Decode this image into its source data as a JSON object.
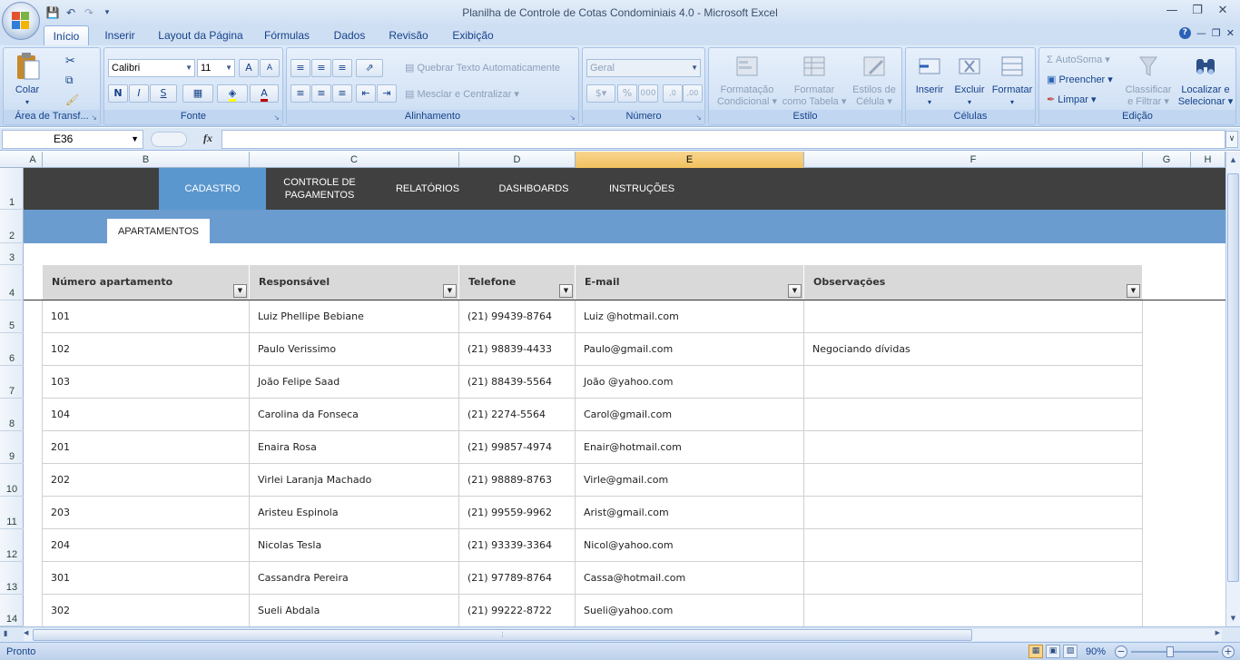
{
  "window": {
    "title": "Planilha de Controle de Cotas Condominiais 4.0  -  Microsoft Excel",
    "controls": [
      "minimize",
      "restore",
      "close"
    ]
  },
  "ribbon_tabs": [
    {
      "label": "Início",
      "active": true
    },
    {
      "label": "Inserir"
    },
    {
      "label": "Layout da Página"
    },
    {
      "label": "Fórmulas"
    },
    {
      "label": "Dados"
    },
    {
      "label": "Revisão"
    },
    {
      "label": "Exibição"
    }
  ],
  "ribbon": {
    "clipboard": {
      "label": "Área de Transf...",
      "paste": "Colar"
    },
    "font": {
      "label": "Fonte",
      "name": "Calibri",
      "size": "11",
      "bold": "N",
      "italic": "I",
      "underline": "S",
      "grow": "A",
      "shrink": "A",
      "color": "A"
    },
    "alignment": {
      "label": "Alinhamento",
      "wrap": "Quebrar Texto Automaticamente",
      "merge": "Mesclar e Centralizar"
    },
    "number": {
      "label": "Número",
      "format": "Geral",
      "percent": "%",
      "thousands": "000",
      "inc_decimal": ",0",
      "dec_decimal": ",00"
    },
    "styles": {
      "label": "Estilo",
      "conditional_1": "Formatação",
      "conditional_2": "Condicional",
      "table_1": "Formatar",
      "table_2": "como Tabela",
      "cell_styles_1": "Estilos de",
      "cell_styles_2": "Célula"
    },
    "cells": {
      "label": "Células",
      "insert": "Inserir",
      "delete": "Excluir",
      "format": "Formatar"
    },
    "editing": {
      "label": "Edição",
      "autosum": "AutoSoma",
      "fill": "Preencher",
      "clear": "Limpar",
      "sort_1": "Classificar",
      "sort_2": "e Filtrar",
      "find_1": "Localizar e",
      "find_2": "Selecionar"
    }
  },
  "formula_bar": {
    "name_box": "E36",
    "fx": "fx",
    "formula": ""
  },
  "columns": [
    {
      "label": "A",
      "selected": false
    },
    {
      "label": "B",
      "selected": false
    },
    {
      "label": "C",
      "selected": false
    },
    {
      "label": "D",
      "selected": false
    },
    {
      "label": "E",
      "selected": true
    },
    {
      "label": "F",
      "selected": false
    },
    {
      "label": "G",
      "selected": false
    },
    {
      "label": "H",
      "selected": false
    }
  ],
  "rows": [
    "1",
    "2",
    "3",
    "4",
    "5",
    "6",
    "7",
    "8",
    "9",
    "10",
    "11",
    "12",
    "13",
    "14"
  ],
  "nav": {
    "items": [
      {
        "label": "CADASTRO",
        "active": true
      },
      {
        "label": "CONTROLE DE PAGAMENTOS",
        "line1": "CONTROLE DE",
        "line2": "PAGAMENTOS"
      },
      {
        "label": "RELATÓRIOS"
      },
      {
        "label": "DASHBOARDS"
      },
      {
        "label": "INSTRUÇÕES"
      }
    ],
    "subtab": "APARTAMENTOS"
  },
  "table": {
    "headers": [
      "Número apartamento",
      "Responsável",
      "Telefone",
      "E-mail",
      "Observações"
    ],
    "rows": [
      [
        "101",
        "Luiz Phellipe Bebiane",
        "(21) 99439-8764",
        "Luiz @hotmail.com",
        ""
      ],
      [
        "102",
        "Paulo Verissimo",
        "(21) 98839-4433",
        "Paulo@gmail.com",
        "Negociando dívidas"
      ],
      [
        "103",
        "João Felipe Saad",
        "(21) 88439-5564",
        "João @yahoo.com",
        ""
      ],
      [
        "104",
        "Carolina da Fonseca",
        "(21) 2274-5564",
        "Carol@gmail.com",
        ""
      ],
      [
        "201",
        "Enaira Rosa",
        "(21) 99857-4974",
        "Enair@hotmail.com",
        ""
      ],
      [
        "202",
        "Virlei Laranja Machado",
        "(21) 98889-8763",
        "Virle@gmail.com",
        ""
      ],
      [
        "203",
        "Aristeu Espinola",
        "(21) 99559-9962",
        "Arist@gmail.com",
        ""
      ],
      [
        "204",
        "Nicolas Tesla",
        "(21) 93339-3364",
        "Nicol@yahoo.com",
        ""
      ],
      [
        "301",
        "Cassandra Pereira",
        "(21) 97789-8764",
        "Cassa@hotmail.com",
        ""
      ],
      [
        "302",
        "Sueli Abdala",
        "(21) 99222-8722",
        "Sueli@yahoo.com",
        ""
      ]
    ]
  },
  "status": {
    "text": "Pronto",
    "zoom": "90%"
  },
  "colors": {
    "nav_bg": "#404040",
    "nav_active": "#5b97cf",
    "subbar": "#6a9cd0",
    "header_bg": "#d9d9d9"
  }
}
